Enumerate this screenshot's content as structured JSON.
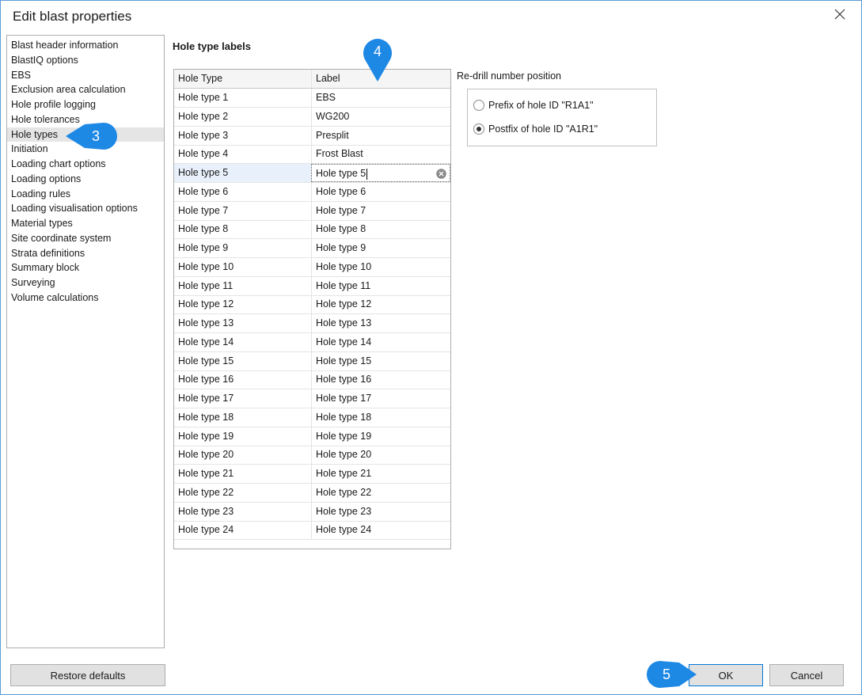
{
  "window": {
    "title": "Edit blast properties"
  },
  "nav": {
    "items": [
      "Blast header information",
      "BlastIQ options",
      "EBS",
      "Exclusion area calculation",
      "Hole profile logging",
      "Hole tolerances",
      "Hole types",
      "Initiation",
      "Loading chart options",
      "Loading options",
      "Loading rules",
      "Loading visualisation options",
      "Material types",
      "Site coordinate system",
      "Strata definitions",
      "Summary block",
      "Surveying",
      "Volume calculations"
    ],
    "selected_index": 6
  },
  "section_title": "Hole type labels",
  "grid": {
    "columns": [
      "Hole Type",
      "Label"
    ],
    "rows": [
      [
        "Hole type 1",
        "EBS"
      ],
      [
        "Hole type 2",
        "WG200"
      ],
      [
        "Hole type 3",
        "Presplit"
      ],
      [
        "Hole type 4",
        "Frost Blast"
      ],
      [
        "Hole type 5",
        "Hole type 5"
      ],
      [
        "Hole type 6",
        "Hole type 6"
      ],
      [
        "Hole type 7",
        "Hole type 7"
      ],
      [
        "Hole type 8",
        "Hole type 8"
      ],
      [
        "Hole type 9",
        "Hole type 9"
      ],
      [
        "Hole type 10",
        "Hole type 10"
      ],
      [
        "Hole type 11",
        "Hole type 11"
      ],
      [
        "Hole type 12",
        "Hole type 12"
      ],
      [
        "Hole type 13",
        "Hole type 13"
      ],
      [
        "Hole type 14",
        "Hole type 14"
      ],
      [
        "Hole type 15",
        "Hole type 15"
      ],
      [
        "Hole type 16",
        "Hole type 16"
      ],
      [
        "Hole type 17",
        "Hole type 17"
      ],
      [
        "Hole type 18",
        "Hole type 18"
      ],
      [
        "Hole type 19",
        "Hole type 19"
      ],
      [
        "Hole type 20",
        "Hole type 20"
      ],
      [
        "Hole type 21",
        "Hole type 21"
      ],
      [
        "Hole type 22",
        "Hole type 22"
      ],
      [
        "Hole type 23",
        "Hole type 23"
      ],
      [
        "Hole type 24",
        "Hole type 24"
      ]
    ],
    "editing_row_index": 4
  },
  "redrill": {
    "label": "Re-drill number position",
    "options": [
      {
        "label": "Prefix of hole ID \"R1A1\"",
        "checked": false
      },
      {
        "label": "Postfix of hole ID \"A1R1\"",
        "checked": true
      }
    ]
  },
  "buttons": {
    "restore": "Restore defaults",
    "ok": "OK",
    "cancel": "Cancel"
  },
  "callouts": [
    "3",
    "4",
    "5"
  ],
  "colors": {
    "accent": "#0078d7",
    "callout": "#1e88e5",
    "selection": "#e5e5e5",
    "window_border": "#5b9bd5"
  },
  "icons": [
    "close-icon",
    "clear-icon",
    "radio-icon"
  ]
}
